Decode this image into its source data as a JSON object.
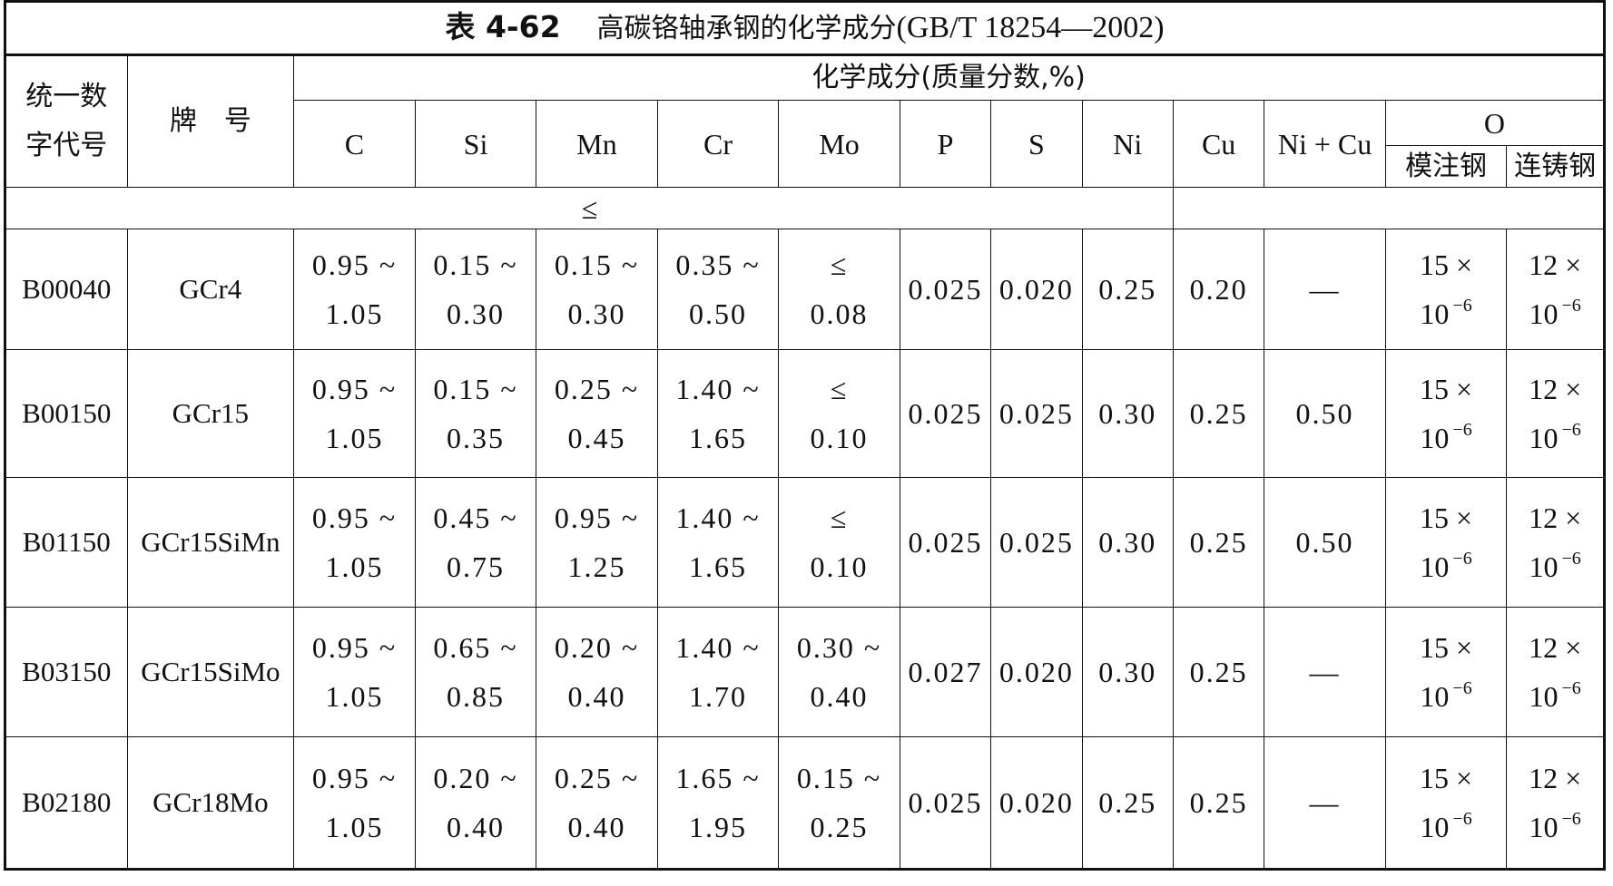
{
  "title": {
    "table_no": "表 4-62",
    "name": "高碳铬轴承钢的化学成分",
    "standard": "(GB/T 18254—2002)"
  },
  "headers": {
    "code_line1": "统一数",
    "code_line2": "字代号",
    "grade": "牌　号",
    "composition": "化学成分(质量分数,%)",
    "C": "C",
    "Si": "Si",
    "Mn": "Mn",
    "Cr": "Cr",
    "Mo": "Mo",
    "P": "P",
    "S": "S",
    "Ni": "Ni",
    "Cu": "Cu",
    "NiCu": "Ni + Cu",
    "O": "O",
    "O_mold": "模注钢",
    "O_cont": "连铸钢",
    "max_sign": "≤"
  },
  "rows": [
    {
      "code": "B00040",
      "grade": "GCr4",
      "C": [
        "0.95 ~",
        "1.05"
      ],
      "Si": [
        "0.15 ~",
        "0.30"
      ],
      "Mn": [
        "0.15 ~",
        "0.30"
      ],
      "Cr": [
        "0.35 ~",
        "0.50"
      ],
      "Mo": [
        "≤",
        "0.08"
      ],
      "P": "0.025",
      "S": "0.020",
      "Ni": "0.25",
      "Cu": "0.20",
      "NiCu": "—",
      "O_mold": [
        "15 ×",
        "10",
        "−6"
      ],
      "O_cont": [
        "12 ×",
        "10",
        "−6"
      ]
    },
    {
      "code": "B00150",
      "grade": "GCr15",
      "C": [
        "0.95 ~",
        "1.05"
      ],
      "Si": [
        "0.15 ~",
        "0.35"
      ],
      "Mn": [
        "0.25 ~",
        "0.45"
      ],
      "Cr": [
        "1.40 ~",
        "1.65"
      ],
      "Mo": [
        "≤",
        "0.10"
      ],
      "P": "0.025",
      "S": "0.025",
      "Ni": "0.30",
      "Cu": "0.25",
      "NiCu": "0.50",
      "O_mold": [
        "15 ×",
        "10",
        "−6"
      ],
      "O_cont": [
        "12 ×",
        "10",
        "−6"
      ]
    },
    {
      "code": "B01150",
      "grade": "GCr15SiMn",
      "C": [
        "0.95 ~",
        "1.05"
      ],
      "Si": [
        "0.45 ~",
        "0.75"
      ],
      "Mn": [
        "0.95 ~",
        "1.25"
      ],
      "Cr": [
        "1.40 ~",
        "1.65"
      ],
      "Mo": [
        "≤",
        "0.10"
      ],
      "P": "0.025",
      "S": "0.025",
      "Ni": "0.30",
      "Cu": "0.25",
      "NiCu": "0.50",
      "O_mold": [
        "15 ×",
        "10",
        "−6"
      ],
      "O_cont": [
        "12 ×",
        "10",
        "−6"
      ]
    },
    {
      "code": "B03150",
      "grade": "GCr15SiMo",
      "C": [
        "0.95 ~",
        "1.05"
      ],
      "Si": [
        "0.65 ~",
        "0.85"
      ],
      "Mn": [
        "0.20 ~",
        "0.40"
      ],
      "Cr": [
        "1.40 ~",
        "1.70"
      ],
      "Mo": [
        "0.30 ~",
        "0.40"
      ],
      "P": "0.027",
      "S": "0.020",
      "Ni": "0.30",
      "Cu": "0.25",
      "NiCu": "—",
      "O_mold": [
        "15 ×",
        "10",
        "−6"
      ],
      "O_cont": [
        "12 ×",
        "10",
        "−6"
      ]
    },
    {
      "code": "B02180",
      "grade": "GCr18Mo",
      "C": [
        "0.95 ~",
        "1.05"
      ],
      "Si": [
        "0.20 ~",
        "0.40"
      ],
      "Mn": [
        "0.25 ~",
        "0.40"
      ],
      "Cr": [
        "1.65 ~",
        "1.95"
      ],
      "Mo": [
        "0.15 ~",
        "0.25"
      ],
      "P": "0.025",
      "S": "0.020",
      "Ni": "0.25",
      "Cu": "0.25",
      "NiCu": "—",
      "O_mold": [
        "15 ×",
        "10",
        "−6"
      ],
      "O_cont": [
        "12 ×",
        "10",
        "−6"
      ]
    }
  ]
}
